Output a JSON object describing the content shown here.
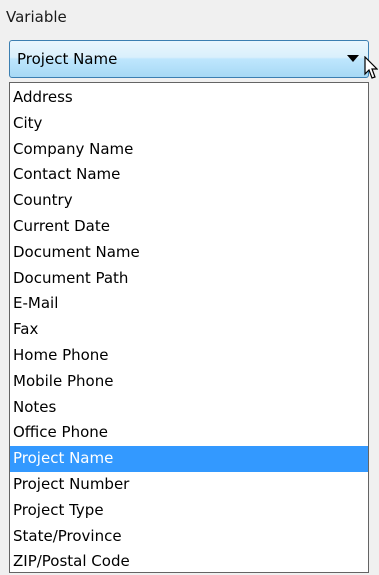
{
  "field": {
    "label": "Variable"
  },
  "combo": {
    "selected_value": "Project Name"
  },
  "icons": {
    "dropdown_arrow": "triangle-down-icon",
    "mouse_cursor": "arrow-pointer-icon"
  },
  "colors": {
    "selection_background": "#3399ff",
    "combo_border": "#3c7fb1"
  },
  "options": [
    {
      "label": "Address",
      "selected": false
    },
    {
      "label": "City",
      "selected": false
    },
    {
      "label": "Company Name",
      "selected": false
    },
    {
      "label": "Contact Name",
      "selected": false
    },
    {
      "label": "Country",
      "selected": false
    },
    {
      "label": "Current Date",
      "selected": false
    },
    {
      "label": "Document Name",
      "selected": false
    },
    {
      "label": "Document Path",
      "selected": false
    },
    {
      "label": "E-Mail",
      "selected": false
    },
    {
      "label": "Fax",
      "selected": false
    },
    {
      "label": "Home Phone",
      "selected": false
    },
    {
      "label": "Mobile Phone",
      "selected": false
    },
    {
      "label": "Notes",
      "selected": false
    },
    {
      "label": "Office Phone",
      "selected": false
    },
    {
      "label": "Project Name",
      "selected": true
    },
    {
      "label": "Project Number",
      "selected": false
    },
    {
      "label": "Project Type",
      "selected": false
    },
    {
      "label": "State/Province",
      "selected": false
    },
    {
      "label": "ZIP/Postal Code",
      "selected": false
    }
  ]
}
